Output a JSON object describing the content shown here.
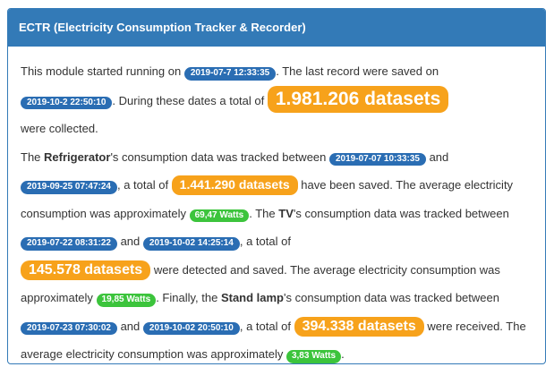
{
  "panel": {
    "title": "ECTR (Electricity Consumption Tracker & Recorder)"
  },
  "summary": {
    "t1": "This module started running on ",
    "start_date": "2019-07-7 12:33:35",
    "t2": ". The last record were saved on ",
    "last_date": "2019-10-2 22:50:10",
    "t3": ". During these dates a total of ",
    "total_datasets": "1.981.206 datasets",
    "t4": "were collected."
  },
  "devices_text": {
    "t_the": "The ",
    "refrigerator_name": "Refrigerator",
    "t_ref_between": "'s consumption data was tracked between ",
    "ref_start": "2019-07-07 10:33:35",
    "t_and": " and ",
    "ref_end": "2019-09-25 07:47:24",
    "t_total_of": ", a total of ",
    "ref_datasets": "1.441.290 datasets",
    "t_ref_saved": " have been saved. The average electricity consumption was approximately ",
    "ref_watts": "69,47 Watts",
    "t_period_the": ". The ",
    "tv_name": "TV",
    "t_tv_between": "'s consumption data was tracked between ",
    "tv_start": "2019-07-22 08:31:22",
    "tv_end": "2019-10-02 14:25:14",
    "t_total_of_2": ", a total of ",
    "tv_datasets": "145.578 datasets",
    "t_tv_detected": " were detected and saved. The average electricity consumption was approximately ",
    "tv_watts": "19,85 Watts",
    "t_finally": ". Finally, the ",
    "lamp_name": "Stand lamp",
    "t_lamp_between": "'s consumption data was tracked between ",
    "lamp_start": "2019-07-23 07:30:02",
    "lamp_end": "2019-10-02 20:50:10",
    "lamp_datasets": "394.338 datasets",
    "t_lamp_received": " were received. The average electricity consumption was approximately ",
    "lamp_watts": "3,83 Watts",
    "t_end": "."
  },
  "colors": {
    "panel_blue": "#337ab7",
    "date_badge": "#2a6db3",
    "count_badge": "#f7a21b",
    "watts_badge": "#3cc43c"
  }
}
